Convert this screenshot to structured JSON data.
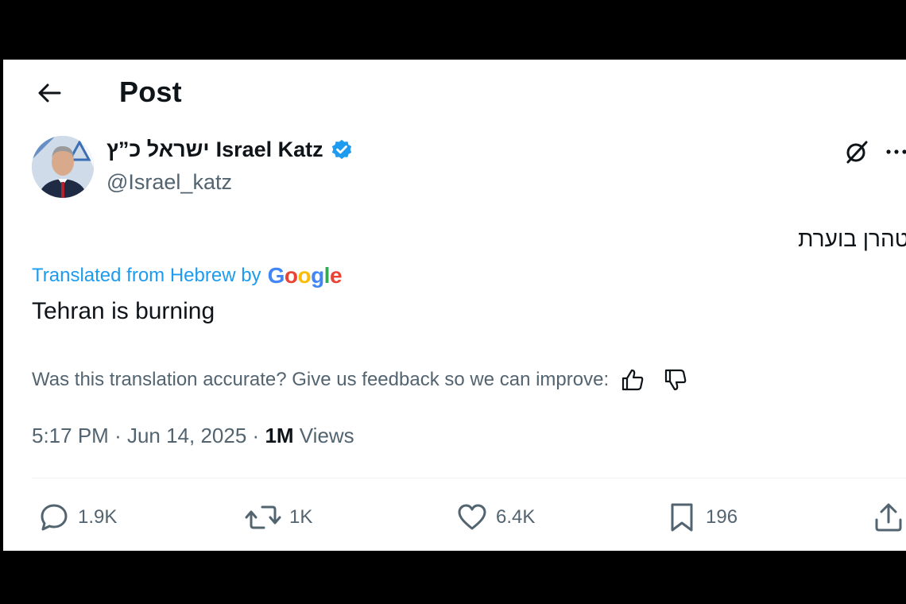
{
  "header": {
    "title": "Post",
    "back_icon": "arrow-left-icon"
  },
  "author": {
    "name_hebrew": "ישראל כ”ץ",
    "name_latin": "Israel Katz",
    "handle": "@Israel_katz",
    "verified_icon": "verified-badge-icon",
    "verified_color": "#1d9bf0"
  },
  "post": {
    "original_text": "טהרן בוערת",
    "translated_label": "Translated from Hebrew by",
    "translator": "Google",
    "translated_text": "Tehran is burning",
    "feedback_prompt": "Was this translation accurate? Give us feedback so we can improve:",
    "time": "5:17 PM",
    "date": "Jun 14, 2025",
    "views_count": "1M",
    "views_label": "Views"
  },
  "actions": {
    "replies": "1.9K",
    "reposts": "1K",
    "likes": "6.4K",
    "bookmarks": "196"
  },
  "icons": [
    "arrow-left-icon",
    "grok-icon",
    "more-icon",
    "thumbs-up-icon",
    "thumbs-down-icon",
    "reply-icon",
    "repost-icon",
    "like-icon",
    "bookmark-icon",
    "share-icon"
  ],
  "colors": {
    "link": "#1d9bf0",
    "text_primary": "#0f1419",
    "text_secondary": "#536471",
    "google_blue": "#4285F4",
    "google_red": "#EA4335",
    "google_yellow": "#FBBC05",
    "google_green": "#34A853"
  }
}
